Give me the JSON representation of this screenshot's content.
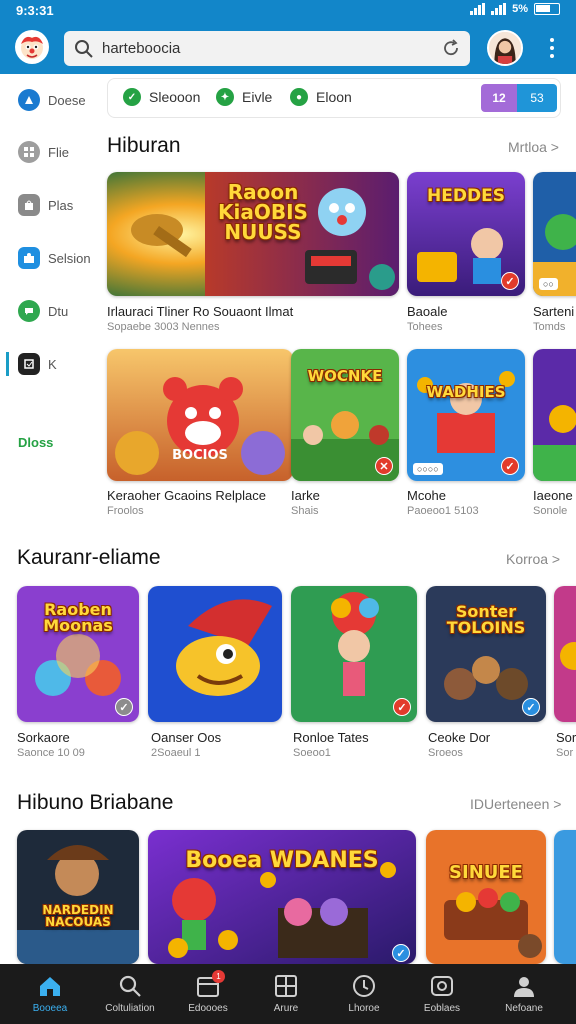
{
  "status_bar": {
    "time": "9:3:31",
    "battery_label": "5%"
  },
  "app_bar": {
    "search": {
      "value": "harteboocia",
      "placeholder": ""
    }
  },
  "sidebar": {
    "items": [
      {
        "label": "Doese",
        "icon": "compass-icon"
      },
      {
        "label": "Flie",
        "icon": "grid-icon"
      },
      {
        "label": "Plas",
        "icon": "bag-icon"
      },
      {
        "label": "Selsion",
        "icon": "puzzle-icon"
      },
      {
        "label": "Dtu",
        "icon": "chat-icon"
      },
      {
        "label": "K",
        "icon": "box-icon"
      },
      {
        "label": "Dloss",
        "icon": "tag-icon"
      }
    ]
  },
  "filters": {
    "chips": [
      "Sleooon",
      "Eivle",
      "Eloon"
    ],
    "seg_left": "12",
    "seg_right": "53"
  },
  "section1": {
    "title": "Hiburan",
    "more": "Mrtloa >",
    "row1": [
      {
        "card_title": "Raoon KiaOBIS NUUSS",
        "label": "Irlauraci Tliner Ro Souaont Ilmat",
        "sub": "Sopaebe 3003    Nennes"
      },
      {
        "card_title": "HEDDES",
        "label": "Baoale",
        "sub": "Tohees"
      },
      {
        "card_title": "",
        "label": "Sarteni",
        "sub": "Tomds"
      }
    ],
    "row2": [
      {
        "card_title": "BOCIOS",
        "label": "Keraoher Gcaoins Relplace",
        "sub": "Froolos"
      },
      {
        "card_title": "WOCNKE",
        "label": "Iarke",
        "sub": "Shais"
      },
      {
        "card_title": "WADHIES",
        "label": "Mcohe",
        "sub": "Paoeoo1 5103"
      },
      {
        "card_title": "",
        "label": "Iaeone",
        "sub": "Sonole"
      }
    ]
  },
  "section2": {
    "title": "Kauranr-eliame",
    "more": "Korroa >",
    "items": [
      {
        "card_title": "Raoben Moonas",
        "label": "Sorkaore",
        "sub": "Saonce 10 09"
      },
      {
        "card_title": "",
        "label": "Oanser Oos",
        "sub": "2Soaeul 1"
      },
      {
        "card_title": "",
        "label": "Ronloe Tates",
        "sub": "Soeoo1"
      },
      {
        "card_title": "Sonter TOLOINS",
        "label": "Ceoke Dor",
        "sub": "Sroeos"
      },
      {
        "card_title": "",
        "label": "Sor",
        "sub": "Sor"
      }
    ]
  },
  "section3": {
    "title": "Hibuno Briabane",
    "more": "IDUerteneen >",
    "items": [
      {
        "card_title": "NARDEDIN NACOUAS"
      },
      {
        "card_title": "Booea WDANES"
      },
      {
        "card_title": "SINUEE"
      },
      {
        "card_title": ""
      }
    ]
  },
  "bottom_nav": [
    {
      "label": "Booeea",
      "icon": "home-icon",
      "active": true
    },
    {
      "label": "Coltuliation",
      "icon": "search-icon"
    },
    {
      "label": "Edoooes",
      "icon": "calendar-icon",
      "badge": "1"
    },
    {
      "label": "Arure",
      "icon": "grid-icon"
    },
    {
      "label": "Lhoroe",
      "icon": "clock-icon"
    },
    {
      "label": "Eoblaes",
      "icon": "camera-icon"
    },
    {
      "label": "Nefoane",
      "icon": "profile-icon"
    }
  ],
  "colors": {
    "brand": "#1286c9",
    "accent": "#3bb0f0",
    "nav_bg": "#1b1b1b"
  }
}
